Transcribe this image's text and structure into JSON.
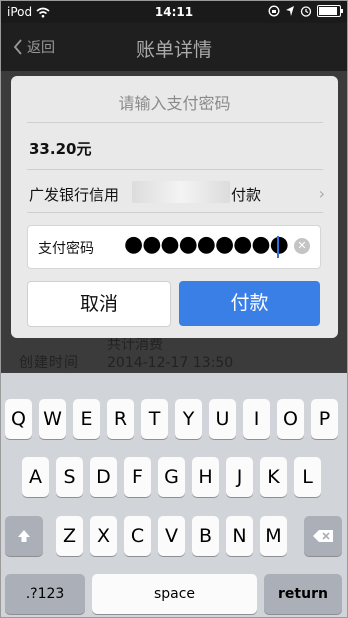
{
  "status_bar": {
    "carrier": "iPod",
    "time": "14:11"
  },
  "nav": {
    "back_label": "返回",
    "title": "账单详情"
  },
  "background": {
    "partial_row_value": "共计消费",
    "created_label": "创建时间",
    "created_value": "2014-12-17 13:50"
  },
  "dialog": {
    "title": "请输入支付密码",
    "amount": "33.20元",
    "card_prefix": "广发银行信用",
    "card_suffix": "付款",
    "password_label": "支付密码",
    "password_mask": "●●●●●●●●●",
    "cancel_label": "取消",
    "pay_label": "付款"
  },
  "keyboard": {
    "row1": [
      "Q",
      "W",
      "E",
      "R",
      "T",
      "Y",
      "U",
      "I",
      "O",
      "P"
    ],
    "row2": [
      "A",
      "S",
      "D",
      "F",
      "G",
      "H",
      "J",
      "K",
      "L"
    ],
    "row3": [
      "Z",
      "X",
      "C",
      "V",
      "B",
      "N",
      "M"
    ],
    "numbers_label": ".?123",
    "space_label": "space",
    "return_label": "return"
  },
  "icons": {
    "wifi": "wifi-icon",
    "lock_rotation": "rotation-lock-icon",
    "location": "location-icon",
    "alarm": "alarm-icon",
    "battery": "battery-icon",
    "back": "chevron-left-icon",
    "disclosure": "chevron-right-icon",
    "clear": "clear-icon",
    "shift": "shift-icon",
    "delete": "backspace-icon"
  },
  "battery_level": 0.9,
  "colors": {
    "accent": "#3a7fe6",
    "navbar": "#1f1f1f",
    "keyboard": "#d1d4d9"
  }
}
